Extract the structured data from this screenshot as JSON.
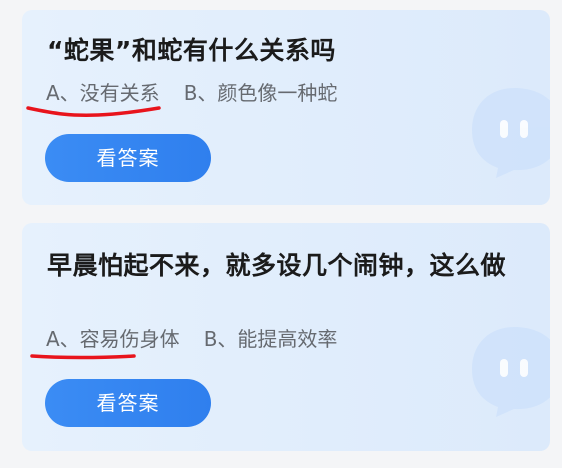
{
  "questions": [
    {
      "title": "“蛇果”和蛇有什么关系吗",
      "option_a": "A、没有关系",
      "option_b": "B、颜色像一种蛇",
      "button": "看答案"
    },
    {
      "title": "早晨怕起不来，就多设几个闹钟，这么做",
      "option_a": "A、容易伤身体",
      "option_b": "B、能提高效率",
      "button": "看答案"
    }
  ],
  "colors": {
    "accent": "#3087f2",
    "annotation": "#e8141c",
    "card": "#e3effc"
  },
  "icons": {
    "mascot": "mascot-bubble-icon"
  }
}
